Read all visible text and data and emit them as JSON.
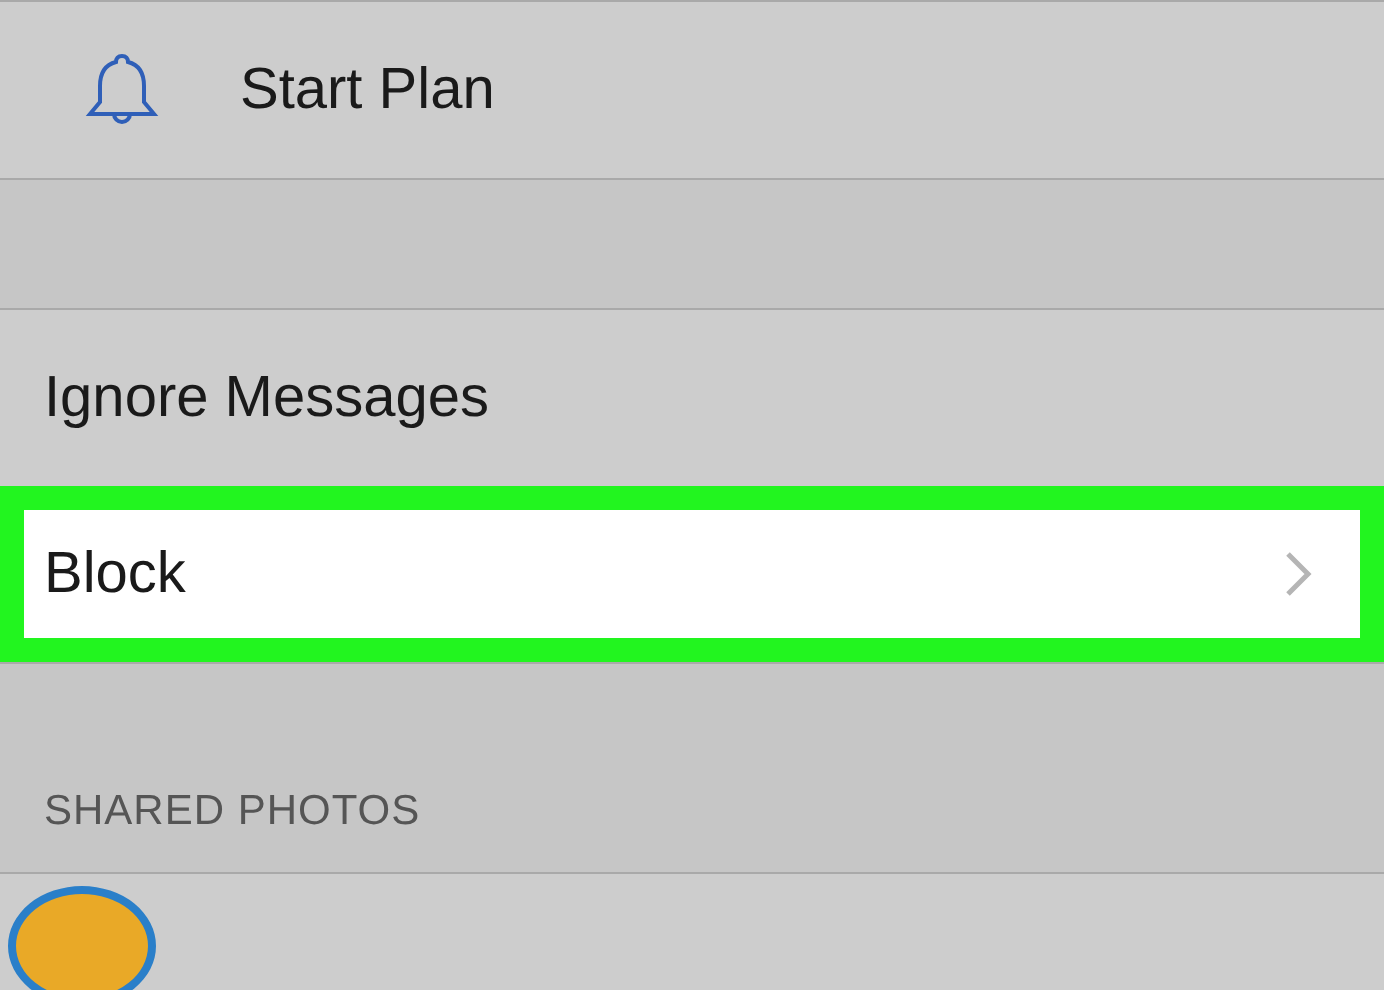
{
  "groups": [
    {
      "items": [
        {
          "label": "Start Plan",
          "kind": "bell",
          "highlighted": false
        }
      ]
    },
    {
      "items": [
        {
          "label": "Ignore Messages",
          "kind": "plain",
          "highlighted": false
        },
        {
          "label": "Block",
          "kind": "disclosure",
          "highlighted": true
        }
      ]
    }
  ],
  "shared_photos": {
    "header": "SHARED PHOTOS"
  }
}
